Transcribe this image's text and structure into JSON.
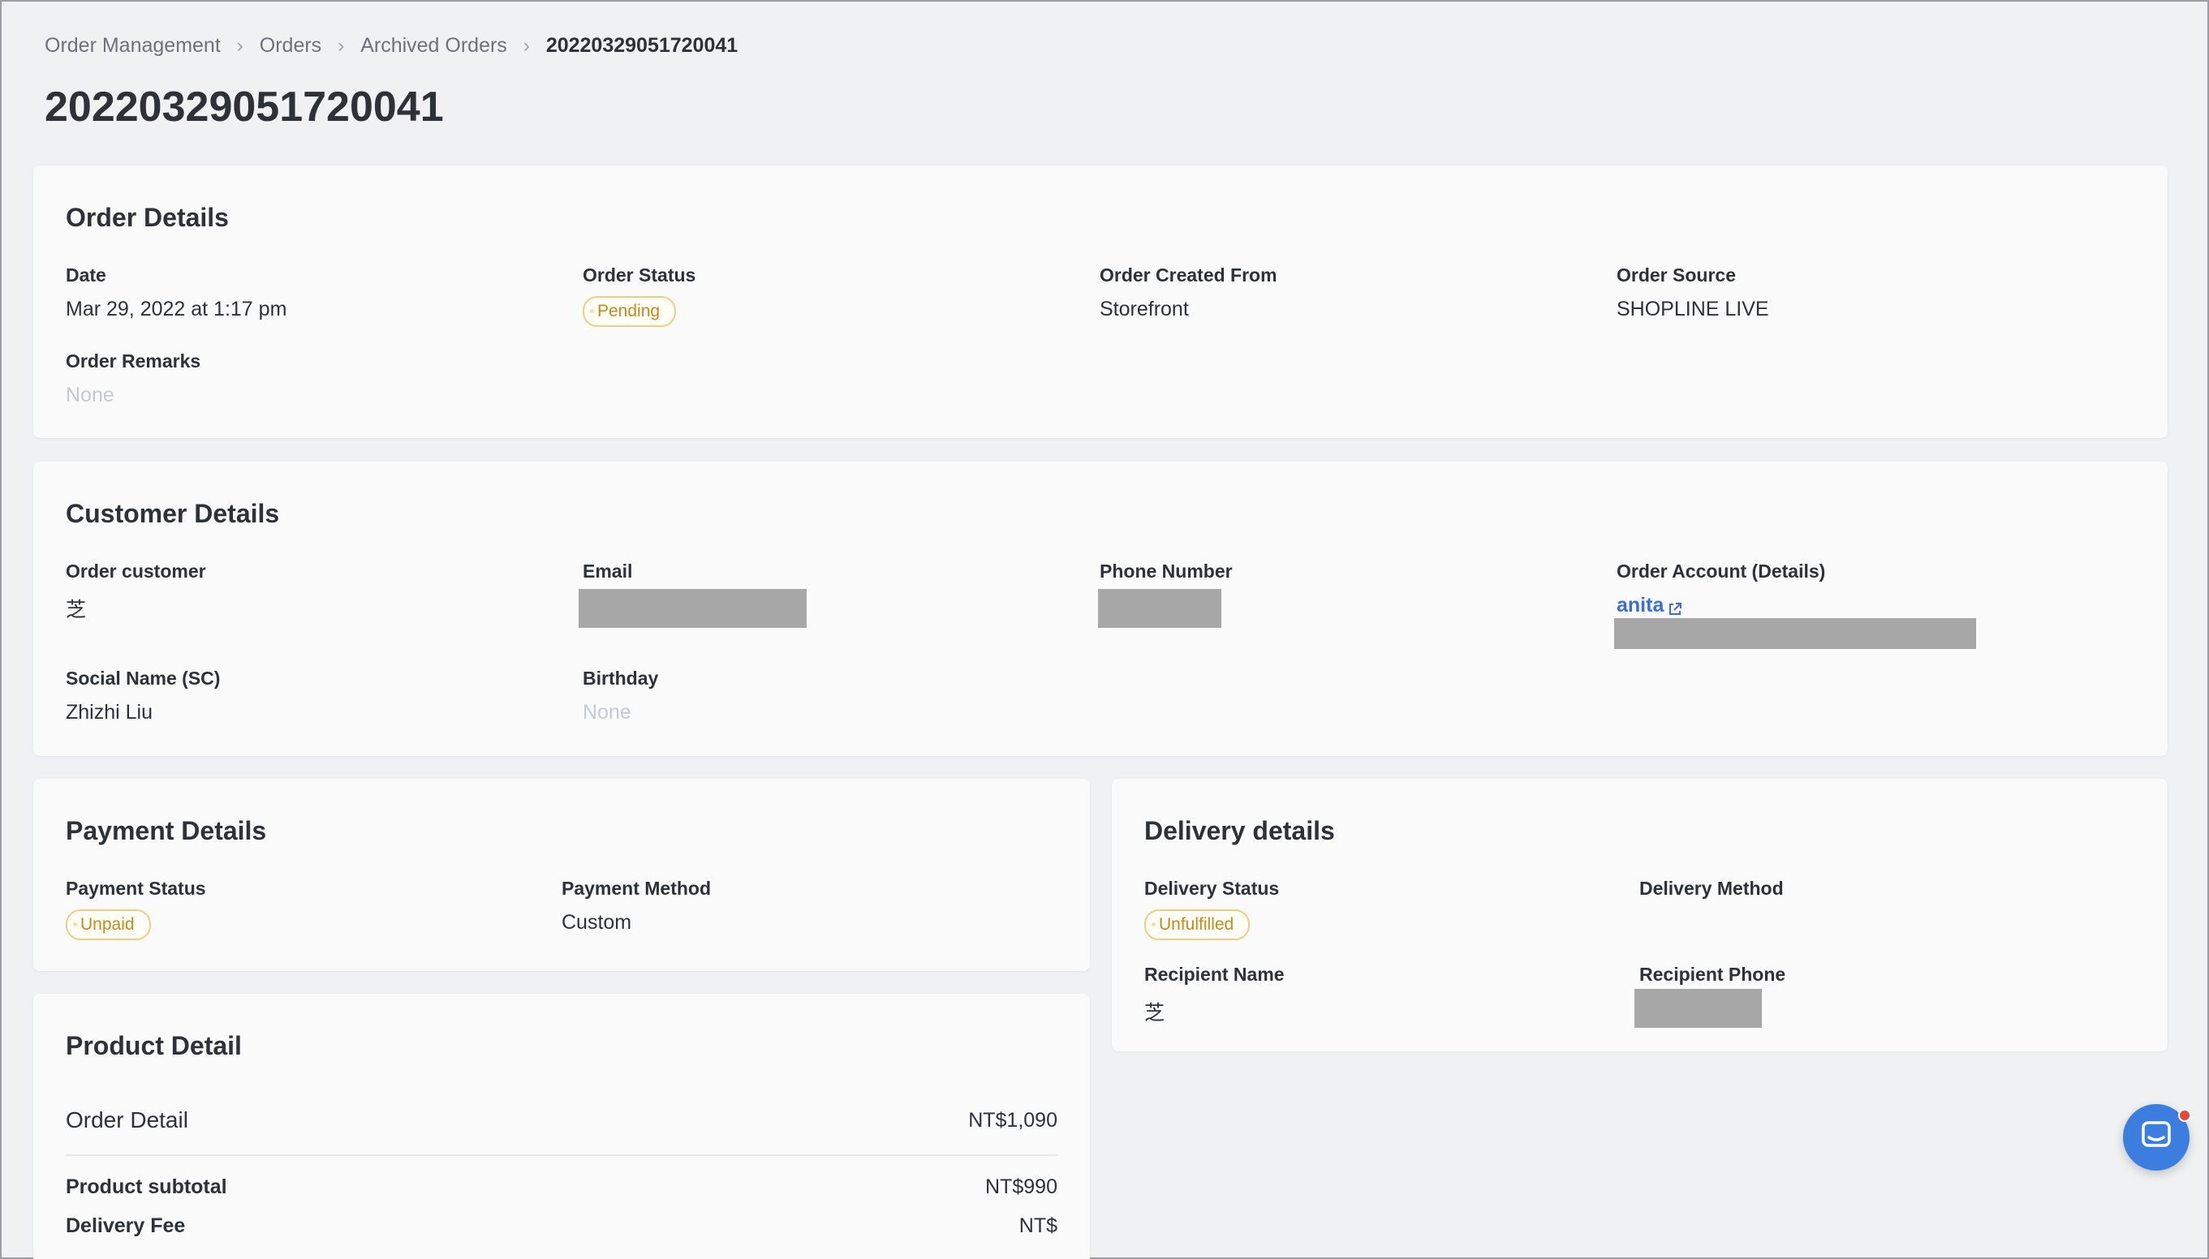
{
  "breadcrumb": {
    "items": [
      "Order Management",
      "Orders",
      "Archived Orders"
    ],
    "current": "20220329051720041"
  },
  "page_title": "20220329051720041",
  "order_details": {
    "title": "Order Details",
    "date_label": "Date",
    "date_value": "Mar 29, 2022 at 1:17 pm",
    "status_label": "Order Status",
    "status_value": "Pending",
    "created_from_label": "Order Created From",
    "created_from_value": "Storefront",
    "source_label": "Order Source",
    "source_value": "SHOPLINE LIVE",
    "remarks_label": "Order Remarks",
    "remarks_value": "None"
  },
  "customer_details": {
    "title": "Customer Details",
    "customer_label": "Order customer",
    "customer_value": "芝",
    "email_label": "Email",
    "phone_label": "Phone Number",
    "account_label": "Order Account (Details)",
    "account_value": "anita",
    "social_label": "Social Name (SC)",
    "social_value": "Zhizhi Liu",
    "birthday_label": "Birthday",
    "birthday_value": "None"
  },
  "payment_details": {
    "title": "Payment Details",
    "status_label": "Payment Status",
    "status_value": "Unpaid",
    "method_label": "Payment Method",
    "method_value": "Custom"
  },
  "delivery_details": {
    "title": "Delivery details",
    "status_label": "Delivery Status",
    "status_value": "Unfulfilled",
    "method_label": "Delivery Method",
    "recipient_name_label": "Recipient Name",
    "recipient_name_value": "芝",
    "recipient_phone_label": "Recipient Phone"
  },
  "product_detail": {
    "title": "Product Detail",
    "order_detail_label": "Order Detail",
    "order_detail_value": "NT$1,090",
    "subtotal_label": "Product subtotal",
    "subtotal_value": "NT$990",
    "delivery_fee_label": "Delivery Fee",
    "delivery_fee_value": "NT$"
  },
  "colors": {
    "accent": "#3a6fd8",
    "badge_text": "#c58a1c",
    "badge_border": "#f1cd83",
    "chat_button": "#3c7ee0",
    "notification": "#e8453c"
  },
  "icons": {
    "breadcrumb_separator": "chevron-right-icon",
    "external_link": "external-link-icon",
    "chat": "chat-icon"
  }
}
